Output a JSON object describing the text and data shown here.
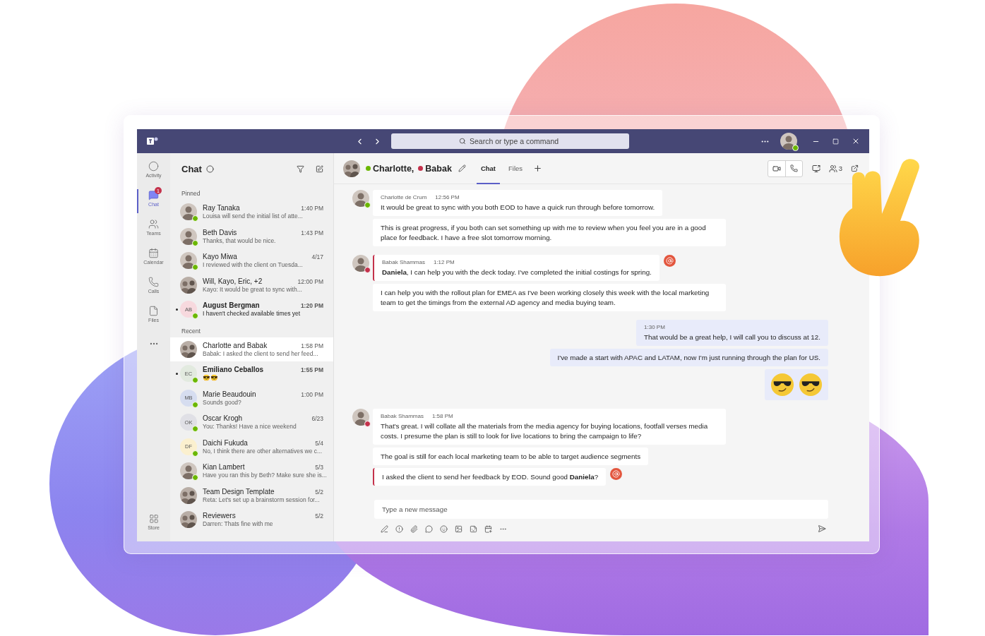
{
  "title_bar": {
    "search": {
      "placeholder": "Search or type a command"
    }
  },
  "rail": [
    {
      "label": "Activity",
      "selected": false
    },
    {
      "label": "Chat",
      "selected": true,
      "badge": "1"
    },
    {
      "label": "Teams",
      "selected": false
    },
    {
      "label": "Calendar",
      "selected": false
    },
    {
      "label": "Calls",
      "selected": false
    },
    {
      "label": "Files",
      "selected": false
    }
  ],
  "rail_bottom": {
    "label": "Store"
  },
  "chat_list": {
    "title": "Chat",
    "sections": [
      {
        "label": "Pinned",
        "items": [
          {
            "name": "Ray Tanaka",
            "time": "1:40 PM",
            "preview": "Louisa will send the initial list of atte...",
            "kind": "photo",
            "online": true,
            "unread": false,
            "selected": false
          },
          {
            "name": "Beth Davis",
            "time": "1:43 PM",
            "preview": "Thanks, that would be nice.",
            "kind": "photo",
            "online": true,
            "unread": false,
            "selected": false
          },
          {
            "name": "Kayo Miwa",
            "time": "4/17",
            "preview": "I reviewed with the client on Tuesda...",
            "kind": "photo",
            "online": true,
            "unread": false,
            "selected": false
          },
          {
            "name": "Will, Kayo, Eric, +2",
            "time": "12:00 PM",
            "preview": "Kayo: It would be great to sync with...",
            "kind": "group",
            "online": false,
            "unread": false,
            "selected": false
          },
          {
            "name": "August Bergman",
            "time": "1:20 PM",
            "preview": "I haven't checked available times yet",
            "kind": "initials",
            "initials": "AB",
            "color": "#f7d9de",
            "online": true,
            "unread": true,
            "selected": false
          }
        ]
      },
      {
        "label": "Recent",
        "items": [
          {
            "name": "Charlotte and Babak",
            "time": "1:58 PM",
            "preview": "Babak: I asked the client to send her feed...",
            "kind": "group",
            "online": false,
            "unread": false,
            "selected": true
          },
          {
            "name": "Emiliano Ceballos",
            "time": "1:55 PM",
            "preview": "😎😎",
            "kind": "initials",
            "initials": "EC",
            "color": "#e2eadf",
            "online": true,
            "unread": true,
            "selected": false
          },
          {
            "name": "Marie Beaudouin",
            "time": "1:00 PM",
            "preview": "Sounds good?",
            "kind": "initials",
            "initials": "MB",
            "color": "#d6ddf0",
            "online": true,
            "unread": false,
            "selected": false
          },
          {
            "name": "Oscar Krogh",
            "time": "6/23",
            "preview": "You: Thanks! Have a nice weekend",
            "kind": "initials",
            "initials": "OK",
            "color": "#e0e0e6",
            "online": true,
            "unread": false,
            "selected": false
          },
          {
            "name": "Daichi Fukuda",
            "time": "5/4",
            "preview": "No, I think there are other alternatives we c...",
            "kind": "initials",
            "initials": "DF",
            "color": "#fbf0cf",
            "online": true,
            "unread": false,
            "selected": false
          },
          {
            "name": "Kian Lambert",
            "time": "5/3",
            "preview": "Have you ran this by Beth? Make sure she is...",
            "kind": "photo",
            "online": true,
            "unread": false,
            "selected": false
          },
          {
            "name": "Team Design Template",
            "time": "5/2",
            "preview": "Reta: Let's set up a brainstorm session for...",
            "kind": "group",
            "online": false,
            "unread": false,
            "selected": false
          },
          {
            "name": "Reviewers",
            "time": "5/2",
            "preview": "Darren: Thats fine with me",
            "kind": "group",
            "online": false,
            "unread": false,
            "selected": false
          }
        ]
      }
    ]
  },
  "conversation": {
    "participants": [
      {
        "name": "Charlotte,",
        "color": "#6bb700"
      },
      {
        "name": "Babak",
        "color": "#c4314b"
      }
    ],
    "tabs": [
      {
        "label": "Chat",
        "selected": true
      },
      {
        "label": "Files",
        "selected": false
      }
    ],
    "people_count": "3",
    "messages": [
      {
        "kind": "incoming",
        "sender": "Charlotte de Crum",
        "time": "12:56 PM",
        "color": "#6bb700",
        "bubbles": [
          {
            "text": "It would be great to sync with you both EOD to have a quick run through before tomorrow.",
            "mention": false
          },
          {
            "text": "This is great progress, if you both can set something up with me to review when you feel you are in a good place for feedback. I have a free slot tomorrow morning.",
            "mention": false
          }
        ]
      },
      {
        "kind": "incoming",
        "sender": "Babak Shammas",
        "time": "1:12 PM",
        "color": "#c4314b",
        "bubbles": [
          {
            "text": "**Daniela**, I can help you with the deck today. I've completed the initial costings for spring.",
            "mention": true
          },
          {
            "text": "I can help you with the rollout plan for EMEA as I've been working closely this week with the local marketing team to get the timings from the external AD agency and media buying team.",
            "mention": false
          }
        ]
      },
      {
        "kind": "outgoing",
        "time": "1:30 PM",
        "bubbles": [
          {
            "kind": "text",
            "text": "That would be a great help, I will call you to discuss at 12."
          },
          {
            "kind": "text",
            "text": "I've made a start with APAC and LATAM, now I'm just running through the plan for US."
          },
          {
            "kind": "emoji"
          }
        ]
      },
      {
        "kind": "incoming",
        "sender": "Babak Shammas",
        "time": "1:58 PM",
        "color": "#c4314b",
        "bubbles": [
          {
            "text": "That's great. I will collate all the materials from the media agency for buying locations, footfall verses media costs. I presume the plan is still to look for live locations to bring the campaign to life?",
            "mention": false
          },
          {
            "text": "The goal is still for each local marketing team to be able to target audience segments",
            "mention": false
          },
          {
            "text": "I asked the client to send her feedback by EOD. Sound good **Daniela**?",
            "mention": true
          }
        ]
      }
    ],
    "composer": {
      "placeholder": "Type a new message"
    }
  }
}
